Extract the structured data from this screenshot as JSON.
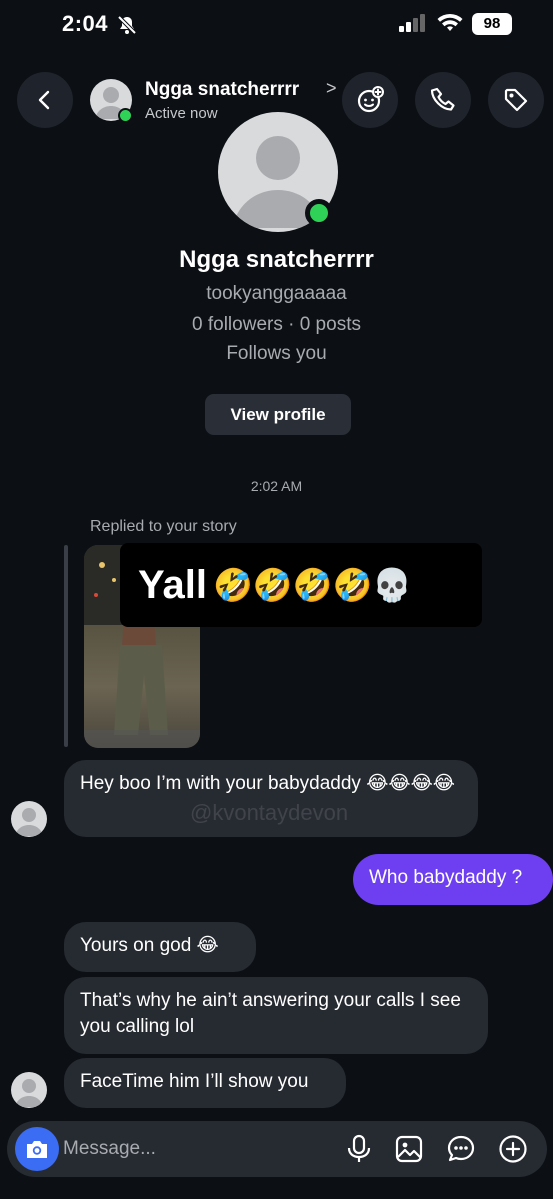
{
  "status_bar": {
    "time": "2:04",
    "battery": "98"
  },
  "header": {
    "name": "Ngga snatcherrrr",
    "chevron": ">",
    "status": "Active now"
  },
  "profile": {
    "name": "Ngga snatcherrrr",
    "username": "tookyanggaaaaa",
    "stats": "0 followers · 0 posts",
    "follows": "Follows you",
    "view_profile": "View profile"
  },
  "timestamp": "2:02 AM",
  "story_reply": {
    "label": "Replied to your story",
    "caption": "Yall",
    "caption_emoji": "🤣🤣🤣🤣💀"
  },
  "messages": [
    {
      "direction": "in",
      "text": "Hey boo I’m with your babydaddy 😂😂😂😂"
    },
    {
      "direction": "out",
      "text": "Who babydaddy ?"
    },
    {
      "direction": "in",
      "text": "Yours on god 😂"
    },
    {
      "direction": "in",
      "text": "That’s why he ain’t answering your calls I see you calling lol"
    },
    {
      "direction": "in",
      "text": "FaceTime him I’ll show you"
    }
  ],
  "watermark": "@kvontaydevon",
  "composer": {
    "placeholder": "Message..."
  },
  "icons": [
    "back-icon",
    "effects-icon",
    "phone-icon",
    "tag-icon",
    "camera-icon",
    "microphone-icon",
    "gallery-icon",
    "sticker-icon",
    "plus-icon",
    "bell-slash-icon",
    "signal-icon",
    "wifi-icon"
  ],
  "colors": {
    "background": "#0c0f14",
    "bubble_in": "#262a31",
    "bubble_out": "#6d3ff0",
    "online": "#2fd157",
    "camera": "#3b6cf4"
  }
}
